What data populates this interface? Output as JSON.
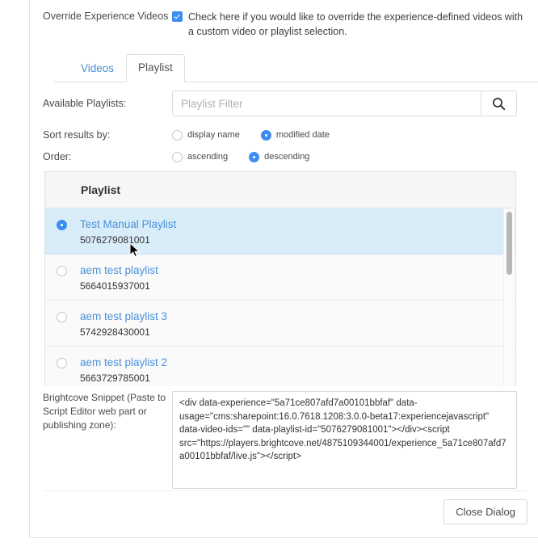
{
  "override": {
    "label": "Override Experience Videos",
    "checkbox_checked": true,
    "checkbox_text": "Check here if you would like to override the experience-defined videos with a custom video or playlist selection."
  },
  "tabs": [
    {
      "label": "Videos",
      "active": false
    },
    {
      "label": "Playlist",
      "active": true
    }
  ],
  "filter": {
    "label": "Available Playlists:",
    "placeholder": "Playlist Filter",
    "value": "",
    "search_icon": "search-icon"
  },
  "sort": {
    "label": "Sort results by:",
    "options": [
      {
        "label": "display name",
        "selected": false
      },
      {
        "label": "modified date",
        "selected": true
      }
    ]
  },
  "order": {
    "label": "Order:",
    "options": [
      {
        "label": "ascending",
        "selected": false
      },
      {
        "label": "descending",
        "selected": true
      }
    ]
  },
  "list": {
    "header": "Playlist",
    "rows": [
      {
        "name": "Test Manual Playlist",
        "id": "5076279081001",
        "selected": true
      },
      {
        "name": "aem test playlist",
        "id": "5664015937001",
        "selected": false
      },
      {
        "name": "aem test playlist 3",
        "id": "5742928430001",
        "selected": false
      },
      {
        "name": "aem test playlist 2",
        "id": "5663729785001",
        "selected": false
      }
    ]
  },
  "snippet": {
    "label": "Brightcove Snippet (Paste to Script Editor web part or publishing zone):",
    "value": "<div data-experience=\"5a71ce807afd7a00101bbfaf\" data-usage=\"cms:sharepoint:16.0.7618.1208:3.0.0-beta17:experiencejavascript\" data-video-ids=\"\" data-playlist-id=\"5076279081001\"></div><script src=\"https://players.brightcove.net/4875109344001/experience_5a71ce807afd7a00101bbfaf/live.js\"></script>"
  },
  "footer": {
    "close_label": "Close Dialog"
  },
  "colors": {
    "accent": "#3c8df0",
    "link": "#4a90d9",
    "selected_row": "#d9edf9",
    "border": "#e0e0e0"
  }
}
